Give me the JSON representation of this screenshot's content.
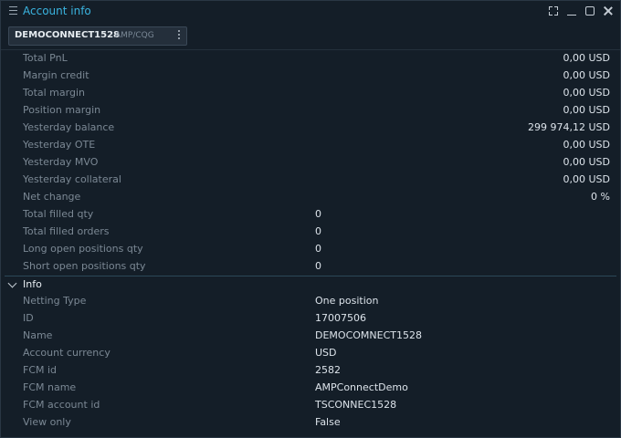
{
  "window": {
    "title": "Account info",
    "controls": [
      "expand-icon",
      "minimize-icon",
      "maximize-icon",
      "close-icon"
    ]
  },
  "account_tab": {
    "name": "DEMOCONNECT1528",
    "connection": "AMP/CQG"
  },
  "metrics": [
    {
      "label": "Total PnL",
      "value": "0,00 USD"
    },
    {
      "label": "Margin credit",
      "value": "0,00 USD"
    },
    {
      "label": "Total margin",
      "value": "0,00 USD"
    },
    {
      "label": "Position margin",
      "value": "0,00 USD"
    },
    {
      "label": "Yesterday balance",
      "value": "299 974,12 USD"
    },
    {
      "label": "Yesterday OTE",
      "value": "0,00 USD"
    },
    {
      "label": "Yesterday MVO",
      "value": "0,00 USD"
    },
    {
      "label": "Yesterday collateral",
      "value": "0,00 USD"
    },
    {
      "label": "Net change",
      "value": "0 %"
    }
  ],
  "counts": [
    {
      "label": "Total filled qty",
      "value": "0"
    },
    {
      "label": "Total filled orders",
      "value": "0"
    },
    {
      "label": "Long open positions qty",
      "value": "0"
    },
    {
      "label": "Short open positions qty",
      "value": "0"
    }
  ],
  "info_group": {
    "label": "Info",
    "rows": [
      {
        "label": "Netting Type",
        "value": "One position"
      },
      {
        "label": "ID",
        "value": "17007506"
      },
      {
        "label": "Name",
        "value": "DEMOCOMNECT1528"
      },
      {
        "label": "Account currency",
        "value": "USD"
      },
      {
        "label": "FCM id",
        "value": "2582"
      },
      {
        "label": "FCM name",
        "value": "AMPConnectDemo"
      },
      {
        "label": "FCM account id",
        "value": "TSCONNEC1528"
      },
      {
        "label": "View only",
        "value": "False"
      }
    ]
  }
}
